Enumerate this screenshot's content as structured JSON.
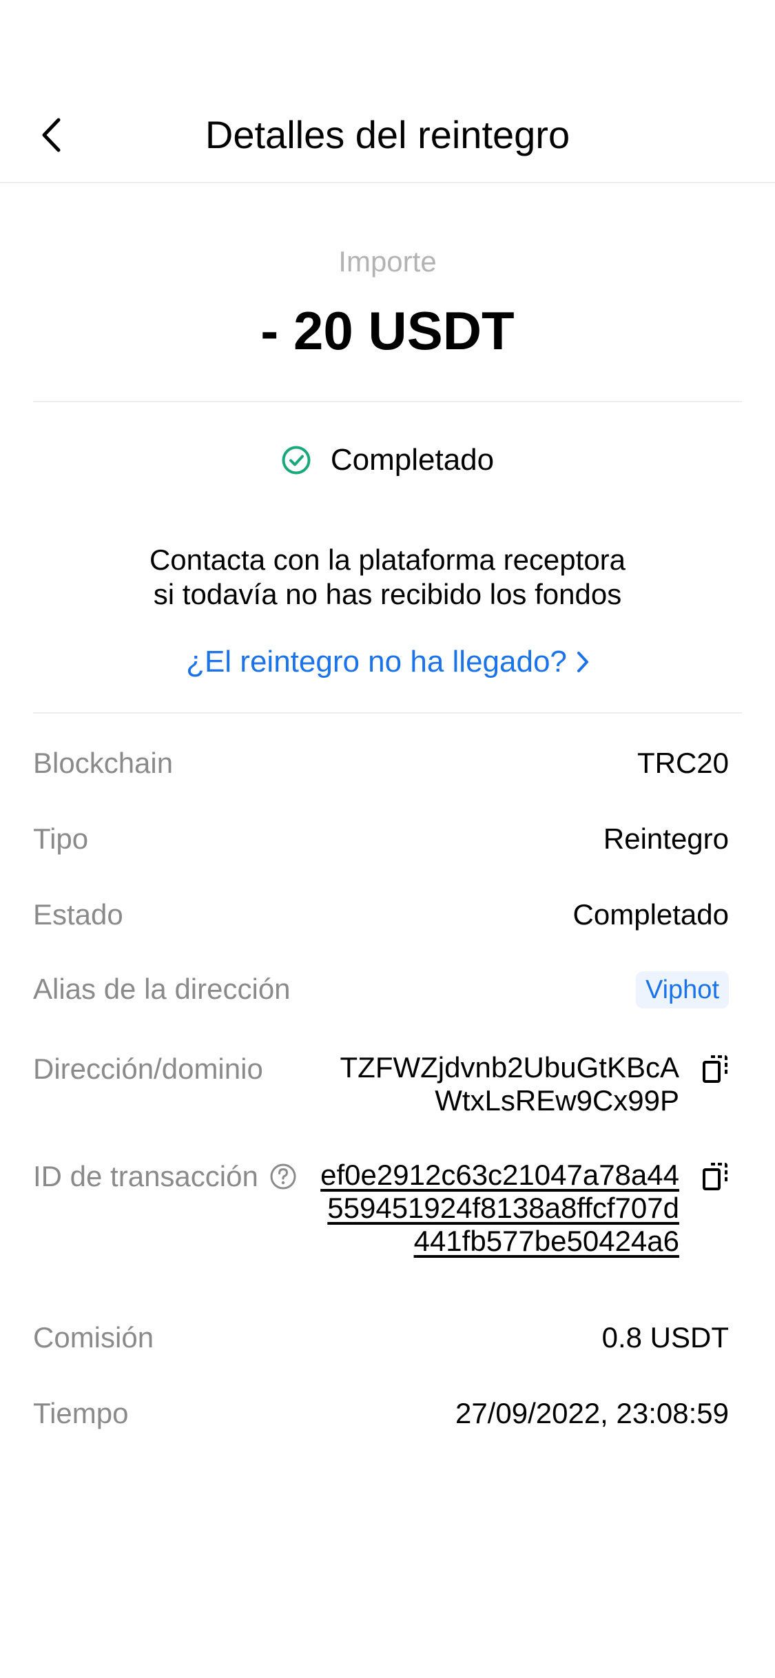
{
  "header": {
    "title": "Detalles del reintegro"
  },
  "amount": {
    "label": "Importe",
    "value": "- 20 USDT"
  },
  "status": {
    "text": "Completado",
    "color": "#1aa87a"
  },
  "notice": {
    "line1": "Contacta con la plataforma receptora",
    "line2": "si todavía no has recibido los fondos"
  },
  "help_link": {
    "text": "¿El reintegro no ha llegado?",
    "color": "#1a73e8"
  },
  "details": {
    "blockchain": {
      "label": "Blockchain",
      "value": "TRC20"
    },
    "tipo": {
      "label": "Tipo",
      "value": "Reintegro"
    },
    "estado": {
      "label": "Estado",
      "value": "Completado"
    },
    "alias": {
      "label": "Alias de la dirección",
      "value": "Viphot"
    },
    "direccion": {
      "label": "Dirección/dominio",
      "lines": [
        "TZFWZjdvnb2UbuGtKBcA",
        "WtxLsREw9Cx99P"
      ]
    },
    "txid": {
      "label": "ID de transacción",
      "lines": [
        "ef0e2912c63c21047a78a44",
        "559451924f8138a8ffcf707d",
        "441fb577be50424a6"
      ]
    },
    "comision": {
      "label": "Comisión",
      "value": "0.8 USDT"
    },
    "tiempo": {
      "label": "Tiempo",
      "value": "27/09/2022, 23:08:59"
    }
  },
  "icons": {
    "back": "chevron-left-icon",
    "status": "check-circle-icon",
    "link_arrow": "chevron-right-icon",
    "copy": "copy-icon",
    "help": "question-circle-icon"
  }
}
